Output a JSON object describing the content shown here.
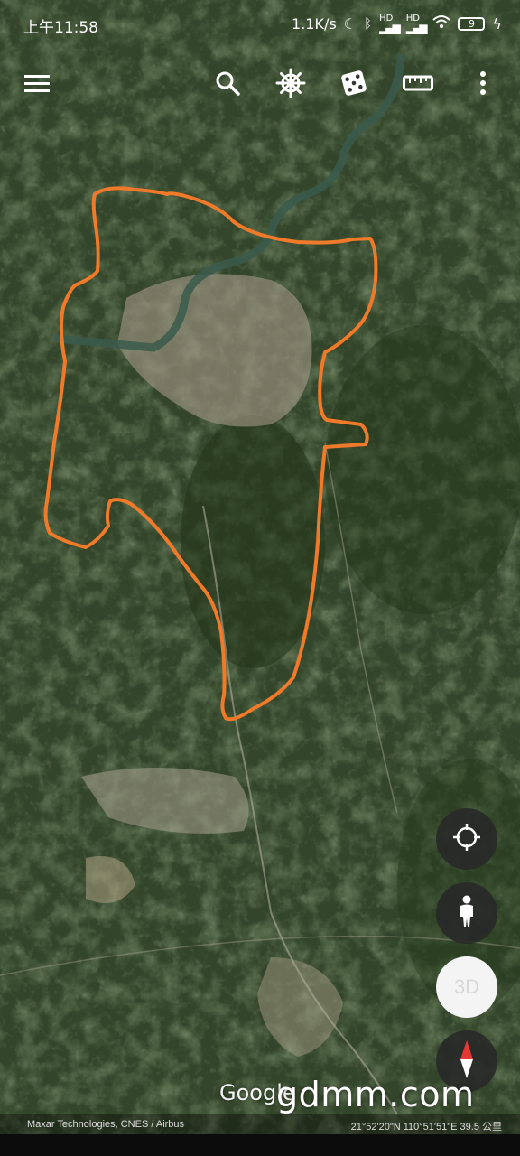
{
  "status_bar": {
    "time": "上午11:58",
    "net_speed": "1.1K/s",
    "battery": "9",
    "hd_label_1": "HD",
    "hd_label_2": "HD"
  },
  "toolbar": {
    "icons": [
      "menu-icon",
      "search-icon",
      "ships-wheel-icon",
      "dice-icon",
      "ruler-icon",
      "more-vertical-icon"
    ]
  },
  "controls": {
    "three_d_label": "3D",
    "icons": [
      "my-location-icon",
      "pegman-icon",
      "compass-icon"
    ]
  },
  "map": {
    "overlay_color": "#f07a2a",
    "google_logo": "Google",
    "watermark": "gdmm.com",
    "attribution": "Maxar Technologies, CNES / Airbus",
    "coordinates": "21°52'20\"N 110°51'51\"E 39.5 公里"
  }
}
